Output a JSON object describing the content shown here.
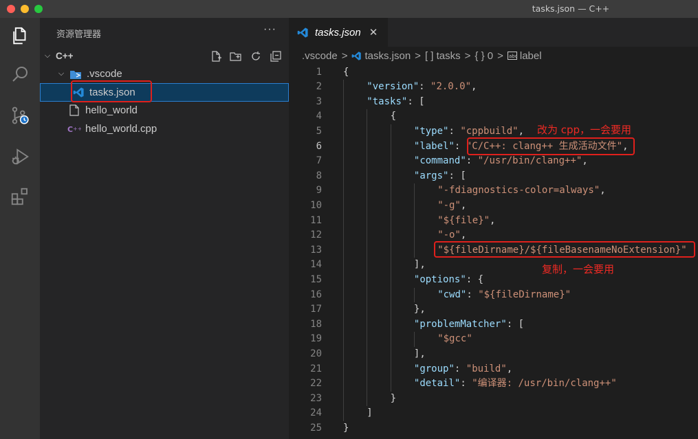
{
  "window": {
    "title": "tasks.json — C++"
  },
  "activity_bar": {
    "items": [
      {
        "name": "explorer-icon"
      },
      {
        "name": "search-icon"
      },
      {
        "name": "source-control-icon"
      },
      {
        "name": "run-debug-icon"
      },
      {
        "name": "extensions-icon"
      }
    ]
  },
  "sidebar": {
    "title": "资源管理器",
    "more": "···",
    "folder": "C++",
    "items": [
      {
        "label": ".vscode",
        "type": "folder"
      },
      {
        "label": "tasks.json",
        "type": "json"
      },
      {
        "label": "hello_world",
        "type": "file"
      },
      {
        "label": "hello_world.cpp",
        "type": "cpp"
      }
    ]
  },
  "tab": {
    "label": "tasks.json",
    "close": "✕"
  },
  "breadcrumb": {
    "parts": [
      ".vscode",
      "tasks.json",
      "[ ] tasks",
      "{ } 0",
      "label"
    ],
    "separator": ">"
  },
  "editor": {
    "active_line": 6,
    "lines": [
      {
        "n": "1",
        "indent": 0,
        "tokens": [
          [
            "p",
            "{"
          ]
        ]
      },
      {
        "n": "2",
        "indent": 1,
        "tokens": [
          [
            "k",
            "\"version\""
          ],
          [
            "p",
            ": "
          ],
          [
            "s",
            "\"2.0.0\""
          ],
          [
            "p",
            ","
          ]
        ]
      },
      {
        "n": "3",
        "indent": 1,
        "tokens": [
          [
            "k",
            "\"tasks\""
          ],
          [
            "p",
            ": ["
          ]
        ]
      },
      {
        "n": "4",
        "indent": 2,
        "tokens": [
          [
            "p",
            "{"
          ]
        ]
      },
      {
        "n": "5",
        "indent": 3,
        "tokens": [
          [
            "k",
            "\"type\""
          ],
          [
            "p",
            ": "
          ],
          [
            "s",
            "\"cppbuild\""
          ],
          [
            "p",
            ","
          ]
        ]
      },
      {
        "n": "6",
        "indent": 3,
        "tokens": [
          [
            "k",
            "\"label\""
          ],
          [
            "p",
            ": "
          ],
          [
            "s",
            "\"C/C++: clang++ 生成活动文件\""
          ],
          [
            "p",
            ","
          ]
        ]
      },
      {
        "n": "7",
        "indent": 3,
        "tokens": [
          [
            "k",
            "\"command\""
          ],
          [
            "p",
            ": "
          ],
          [
            "s",
            "\"/usr/bin/clang++\""
          ],
          [
            "p",
            ","
          ]
        ]
      },
      {
        "n": "8",
        "indent": 3,
        "tokens": [
          [
            "k",
            "\"args\""
          ],
          [
            "p",
            ": ["
          ]
        ]
      },
      {
        "n": "9",
        "indent": 4,
        "tokens": [
          [
            "s",
            "\"-fdiagnostics-color=always\""
          ],
          [
            "p",
            ","
          ]
        ]
      },
      {
        "n": "10",
        "indent": 4,
        "tokens": [
          [
            "s",
            "\"-g\""
          ],
          [
            "p",
            ","
          ]
        ]
      },
      {
        "n": "11",
        "indent": 4,
        "tokens": [
          [
            "s",
            "\"${file}\""
          ],
          [
            "p",
            ","
          ]
        ]
      },
      {
        "n": "12",
        "indent": 4,
        "tokens": [
          [
            "s",
            "\"-o\""
          ],
          [
            "p",
            ","
          ]
        ]
      },
      {
        "n": "13",
        "indent": 4,
        "tokens": [
          [
            "s",
            "\"${fileDirname}/${fileBasenameNoExtension}\""
          ]
        ]
      },
      {
        "n": "14",
        "indent": 3,
        "tokens": [
          [
            "p",
            "],"
          ]
        ]
      },
      {
        "n": "15",
        "indent": 3,
        "tokens": [
          [
            "k",
            "\"options\""
          ],
          [
            "p",
            ": {"
          ]
        ]
      },
      {
        "n": "16",
        "indent": 4,
        "tokens": [
          [
            "k",
            "\"cwd\""
          ],
          [
            "p",
            ": "
          ],
          [
            "s",
            "\"${fileDirname}\""
          ]
        ]
      },
      {
        "n": "17",
        "indent": 3,
        "tokens": [
          [
            "p",
            "},"
          ]
        ]
      },
      {
        "n": "18",
        "indent": 3,
        "tokens": [
          [
            "k",
            "\"problemMatcher\""
          ],
          [
            "p",
            ": ["
          ]
        ]
      },
      {
        "n": "19",
        "indent": 4,
        "tokens": [
          [
            "s",
            "\"$gcc\""
          ]
        ]
      },
      {
        "n": "20",
        "indent": 3,
        "tokens": [
          [
            "p",
            "],"
          ]
        ]
      },
      {
        "n": "21",
        "indent": 3,
        "tokens": [
          [
            "k",
            "\"group\""
          ],
          [
            "p",
            ": "
          ],
          [
            "s",
            "\"build\""
          ],
          [
            "p",
            ","
          ]
        ]
      },
      {
        "n": "22",
        "indent": 3,
        "tokens": [
          [
            "k",
            "\"detail\""
          ],
          [
            "p",
            ": "
          ],
          [
            "s",
            "\"编译器: /usr/bin/clang++\""
          ]
        ]
      },
      {
        "n": "23",
        "indent": 2,
        "tokens": [
          [
            "p",
            "}"
          ]
        ]
      },
      {
        "n": "24",
        "indent": 1,
        "tokens": [
          [
            "p",
            "]"
          ]
        ]
      },
      {
        "n": "25",
        "indent": 0,
        "tokens": [
          [
            "p",
            "}"
          ]
        ]
      }
    ]
  },
  "annotations": {
    "label_note": "改为 cpp，一会要用",
    "args_note": "复制，一会要用",
    "highlight_color": "#e0201c"
  }
}
